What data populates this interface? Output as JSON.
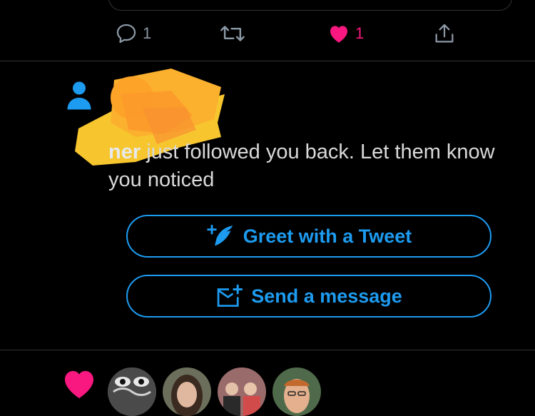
{
  "tweet_actions": {
    "reply_count": "1",
    "retweet_count": "",
    "like_count": "1"
  },
  "notification": {
    "name_visible": "ner",
    "message": " just followed you back. Let them know you noticed"
  },
  "buttons": {
    "greet_label": "Greet with a Tweet",
    "message_label": "Send a message"
  },
  "colors": {
    "accent": "#1d9bf0",
    "like": "#f91880",
    "background": "#000000",
    "divider": "#2f3336"
  },
  "icons": [
    "reply-icon",
    "retweet-icon",
    "like-icon",
    "share-icon",
    "person-icon",
    "feather-plus-icon",
    "mail-plus-icon",
    "heart-icon"
  ]
}
